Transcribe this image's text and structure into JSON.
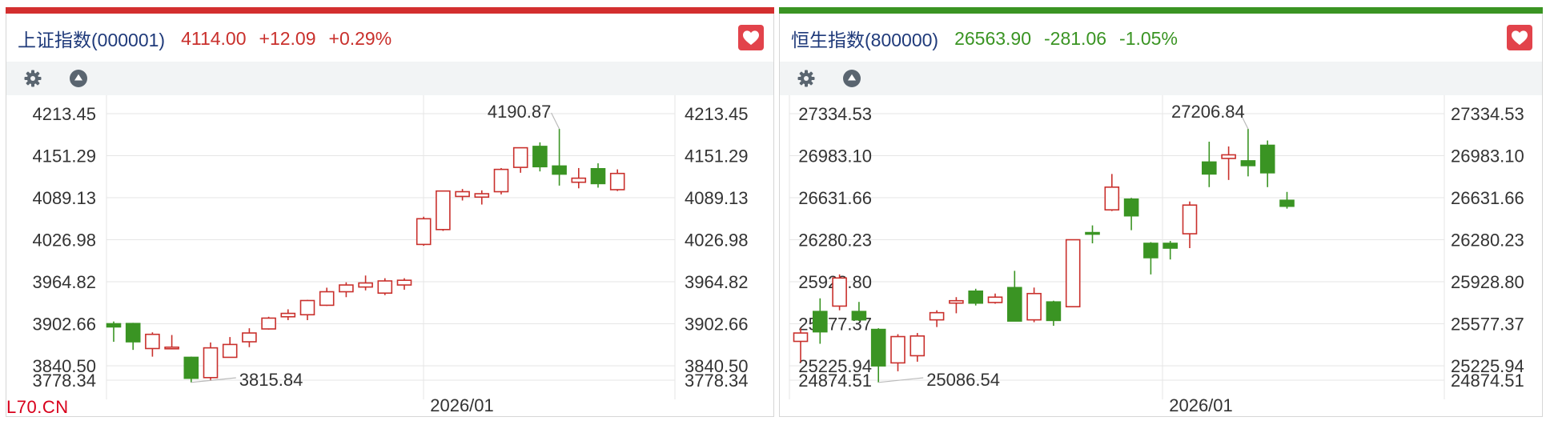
{
  "colors": {
    "up": "#c9302c",
    "down": "#3a9423",
    "grid": "#e6e6e6",
    "axis_text": "#333333",
    "name_blue": "#1f3a7a",
    "fav_bg": "#e2434b",
    "toolbar_bg": "#f2f4f5",
    "icon": "#5a6570"
  },
  "watermark": "L70.CN",
  "panels": [
    {
      "header": {
        "name": "上证指数(000001)",
        "price": "4114.00",
        "change": "+12.09",
        "pct": "+0.29%",
        "trend": "up"
      },
      "toolbar": {
        "icons": [
          "gear-icon",
          "collapse-up-icon"
        ]
      },
      "fav_icon": "heart-icon"
    },
    {
      "header": {
        "name": "恒生指数(800000)",
        "price": "26563.90",
        "change": "-281.06",
        "pct": "-1.05%",
        "trend": "down"
      },
      "toolbar": {
        "icons": [
          "gear-icon",
          "collapse-up-icon"
        ]
      },
      "fav_icon": "heart-icon"
    }
  ],
  "chart_data": [
    {
      "type": "candlestick",
      "title": "上证指数(000001)",
      "x_tick_labels": [
        "2026/01"
      ],
      "y_tick_labels": [
        "4213.45",
        "4151.29",
        "4089.13",
        "4026.98",
        "3964.82",
        "3902.66",
        "3840.50",
        "3778.34"
      ],
      "ylim": [
        3778.34,
        4213.45
      ],
      "annotations": [
        {
          "text": "4190.87",
          "kind": "high",
          "value": 4190.87
        },
        {
          "text": "3815.84",
          "kind": "low",
          "value": 3815.84
        }
      ],
      "candles": [
        {
          "open": 3902.7,
          "high": 3906.0,
          "low": 3876.0,
          "close": 3898.0
        },
        {
          "open": 3903.0,
          "high": 3904.0,
          "low": 3864.0,
          "close": 3876.0
        },
        {
          "open": 3866.0,
          "high": 3890.0,
          "low": 3854.0,
          "close": 3887.0
        },
        {
          "open": 3867.0,
          "high": 3886.0,
          "low": 3866.0,
          "close": 3868.0
        },
        {
          "open": 3853.0,
          "high": 3854.0,
          "low": 3815.84,
          "close": 3822.0
        },
        {
          "open": 3823.0,
          "high": 3875.0,
          "low": 3818.0,
          "close": 3867.0
        },
        {
          "open": 3853.0,
          "high": 3883.0,
          "low": 3853.0,
          "close": 3872.0
        },
        {
          "open": 3876.0,
          "high": 3896.0,
          "low": 3868.0,
          "close": 3889.0
        },
        {
          "open": 3895.0,
          "high": 3913.0,
          "low": 3894.0,
          "close": 3911.0
        },
        {
          "open": 3913.0,
          "high": 3924.0,
          "low": 3908.0,
          "close": 3918.0
        },
        {
          "open": 3916.0,
          "high": 3938.0,
          "low": 3908.0,
          "close": 3937.0
        },
        {
          "open": 3930.0,
          "high": 3956.0,
          "low": 3929.0,
          "close": 3950.0
        },
        {
          "open": 3950.0,
          "high": 3964.0,
          "low": 3942.0,
          "close": 3960.0
        },
        {
          "open": 3957.0,
          "high": 3974.0,
          "low": 3952.0,
          "close": 3963.0
        },
        {
          "open": 3948.0,
          "high": 3970.0,
          "low": 3945.0,
          "close": 3966.0
        },
        {
          "open": 3960.0,
          "high": 3970.0,
          "low": 3953.0,
          "close": 3967.0
        },
        {
          "open": 4020.0,
          "high": 4061.0,
          "low": 4018.0,
          "close": 4058.0
        },
        {
          "open": 4042.0,
          "high": 4099.0,
          "low": 4040.0,
          "close": 4099.0
        },
        {
          "open": 4091.0,
          "high": 4102.0,
          "low": 4085.0,
          "close": 4098.0
        },
        {
          "open": 4090.0,
          "high": 4100.0,
          "low": 4079.0,
          "close": 4095.0
        },
        {
          "open": 4098.0,
          "high": 4133.0,
          "low": 4094.0,
          "close": 4131.0
        },
        {
          "open": 4134.0,
          "high": 4163.0,
          "low": 4126.0,
          "close": 4163.0
        },
        {
          "open": 4165.0,
          "high": 4171.0,
          "low": 4128.0,
          "close": 4135.0
        },
        {
          "open": 4136.0,
          "high": 4190.87,
          "low": 4107.0,
          "close": 4124.0
        },
        {
          "open": 4112.0,
          "high": 4133.0,
          "low": 4103.0,
          "close": 4118.0
        },
        {
          "open": 4132.0,
          "high": 4140.0,
          "low": 4104.0,
          "close": 4110.0
        },
        {
          "open": 4101.0,
          "high": 4131.0,
          "low": 4099.0,
          "close": 4125.0
        }
      ]
    },
    {
      "type": "candlestick",
      "title": "恒生指数(800000)",
      "x_tick_labels": [
        "2026/01"
      ],
      "y_tick_labels": [
        "27334.53",
        "26983.10",
        "26631.66",
        "26280.23",
        "25928.80",
        "25577.37",
        "25225.94",
        "24874.51"
      ],
      "ylim": [
        24874.51,
        27334.53
      ],
      "annotations": [
        {
          "text": "27206.84",
          "kind": "high",
          "value": 27206.84
        },
        {
          "text": "25086.54",
          "kind": "low",
          "value": 25086.54
        }
      ],
      "candles": [
        {
          "open": 25430.0,
          "high": 25540.0,
          "low": 25255.0,
          "close": 25500.0
        },
        {
          "open": 25680.0,
          "high": 25790.0,
          "low": 25410.0,
          "close": 25510.0
        },
        {
          "open": 25725.0,
          "high": 25990.0,
          "low": 25690.0,
          "close": 25960.0
        },
        {
          "open": 25680.0,
          "high": 25760.0,
          "low": 25600.0,
          "close": 25610.0
        },
        {
          "open": 25530.0,
          "high": 25540.0,
          "low": 25086.54,
          "close": 25225.0
        },
        {
          "open": 25250.0,
          "high": 25490.0,
          "low": 25180.0,
          "close": 25470.0
        },
        {
          "open": 25310.0,
          "high": 25500.0,
          "low": 25260.0,
          "close": 25475.0
        },
        {
          "open": 25610.0,
          "high": 25690.0,
          "low": 25550.0,
          "close": 25670.0
        },
        {
          "open": 25750.0,
          "high": 25800.0,
          "low": 25665.0,
          "close": 25770.0
        },
        {
          "open": 25850.0,
          "high": 25870.0,
          "low": 25730.0,
          "close": 25750.0
        },
        {
          "open": 25755.0,
          "high": 25830.0,
          "low": 25745.0,
          "close": 25800.0
        },
        {
          "open": 25880.0,
          "high": 26020.0,
          "low": 25600.0,
          "close": 25600.0
        },
        {
          "open": 25610.0,
          "high": 25880.0,
          "low": 25590.0,
          "close": 25830.0
        },
        {
          "open": 25760.0,
          "high": 25770.0,
          "low": 25560.0,
          "close": 25605.0
        },
        {
          "open": 25720.0,
          "high": 26280.0,
          "low": 25715.0,
          "close": 26280.0
        },
        {
          "open": 26340.0,
          "high": 26400.0,
          "low": 26250.0,
          "close": 26330.0
        },
        {
          "open": 26530.0,
          "high": 26830.0,
          "low": 26520.0,
          "close": 26720.0
        },
        {
          "open": 26620.0,
          "high": 26630.0,
          "low": 26360.0,
          "close": 26480.0
        },
        {
          "open": 26250.0,
          "high": 26260.0,
          "low": 25990.0,
          "close": 26130.0
        },
        {
          "open": 26250.0,
          "high": 26270.0,
          "low": 26115.0,
          "close": 26210.0
        },
        {
          "open": 26330.0,
          "high": 26600.0,
          "low": 26210.0,
          "close": 26570.0
        },
        {
          "open": 26930.0,
          "high": 27100.0,
          "low": 26720.0,
          "close": 26830.0
        },
        {
          "open": 26960.0,
          "high": 27060.0,
          "low": 26780.0,
          "close": 26990.0
        },
        {
          "open": 26940.0,
          "high": 27206.84,
          "low": 26810.0,
          "close": 26900.0
        },
        {
          "open": 27070.0,
          "high": 27110.0,
          "low": 26720.0,
          "close": 26840.0
        },
        {
          "open": 26610.0,
          "high": 26680.0,
          "low": 26540.0,
          "close": 26560.0
        }
      ]
    }
  ]
}
